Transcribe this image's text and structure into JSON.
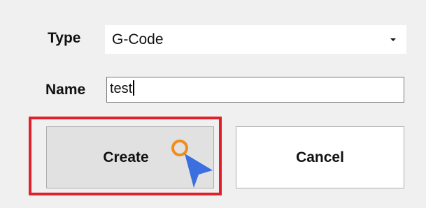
{
  "form": {
    "type_label": "Type",
    "type_value": "G-Code",
    "name_label": "Name",
    "name_value": "test"
  },
  "buttons": {
    "create_label": "Create",
    "cancel_label": "Cancel"
  },
  "icons": {
    "dropdown": "chevron-down-icon",
    "cursor": "mouse-pointer-icon"
  },
  "colors": {
    "highlight": "#e0202a",
    "cursor_ring": "#f28c1a",
    "cursor_pointer": "#3b6fe0"
  }
}
